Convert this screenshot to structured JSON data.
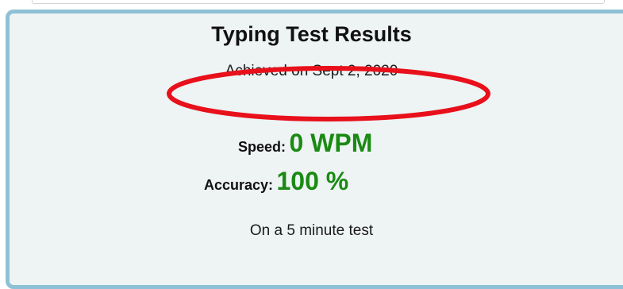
{
  "results": {
    "title": "Typing Test Results",
    "achieved": "Achieved on Sept 2, 2020",
    "speed_label": "Speed:",
    "speed_value": "0 WPM",
    "accuracy_label": "Accuracy:",
    "accuracy_value": "100 %",
    "test_length": "On a 5 minute test"
  },
  "colors": {
    "card_border": "#8fc1d6",
    "card_background": "#eef3f4",
    "stat_value": "#1a8a12",
    "annotation": "#e8101a"
  }
}
